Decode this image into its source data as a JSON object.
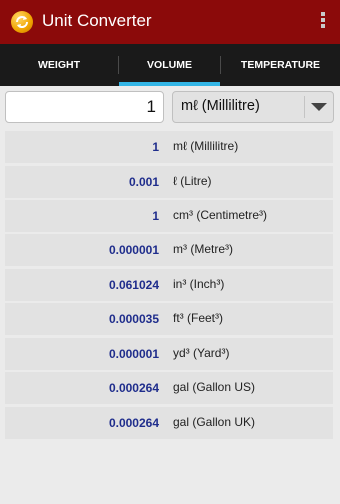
{
  "app": {
    "title": "Unit Converter",
    "icon": "refresh-icon",
    "menu_icon": "overflow-menu-icon"
  },
  "colors": {
    "appbar": "#8b0a0a",
    "tabbar": "#1a1a1a",
    "tab_indicator": "#33b5e5",
    "value_text": "#1f2d8c"
  },
  "tabs": [
    {
      "label": "WEIGHT",
      "selected": false
    },
    {
      "label": "VOLUME",
      "selected": true
    },
    {
      "label": "TEMPERATURE",
      "selected": false
    }
  ],
  "input": {
    "value": "1"
  },
  "unit_select": {
    "selected": "mℓ (Millilitre)"
  },
  "results": [
    {
      "value": "1",
      "unit": "mℓ (Millilitre)"
    },
    {
      "value": "0.001",
      "unit": "ℓ (Litre)"
    },
    {
      "value": "1",
      "unit": "cm³ (Centimetre³)"
    },
    {
      "value": "0.000001",
      "unit": "m³ (Metre³)"
    },
    {
      "value": "0.061024",
      "unit": "in³ (Inch³)"
    },
    {
      "value": "0.000035",
      "unit": "ft³ (Feet³)"
    },
    {
      "value": "0.000001",
      "unit": "yd³ (Yard³)"
    },
    {
      "value": "0.000264",
      "unit": "gal (Gallon US)"
    },
    {
      "value": "0.000264",
      "unit": "gal (Gallon UK)"
    }
  ]
}
